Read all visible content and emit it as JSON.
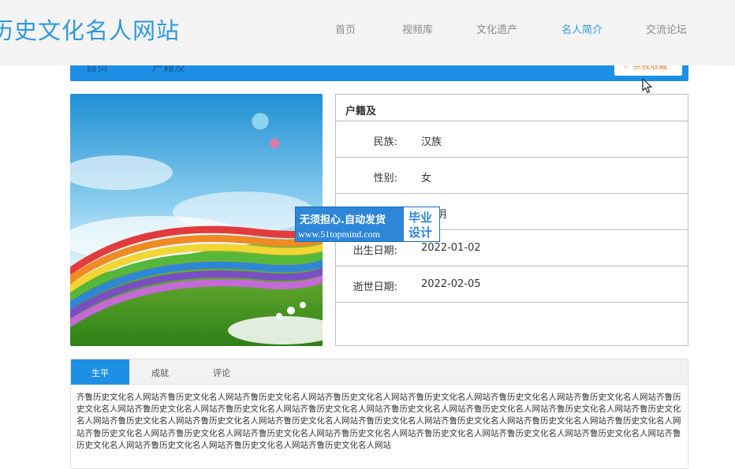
{
  "header": {
    "site_title": "历史文化名人网站",
    "nav": [
      {
        "label": "首页",
        "active": false
      },
      {
        "label": "视频库",
        "active": false
      },
      {
        "label": "文化遗产",
        "active": false
      },
      {
        "label": "名人简介",
        "active": true
      },
      {
        "label": "交流论坛",
        "active": false
      }
    ]
  },
  "breadcrumb": {
    "home": "首页",
    "current": "户籍及",
    "favorite_label": "☆ 点我收藏"
  },
  "person": {
    "name": "户籍及",
    "fields": [
      {
        "label": "民族:",
        "value": "汉族"
      },
      {
        "label": "性别:",
        "value": "女"
      },
      {
        "label": "",
        "value": "明"
      },
      {
        "label": "出生日期:",
        "value": "2022-01-02"
      },
      {
        "label": "逝世日期:",
        "value": "2022-02-05"
      }
    ]
  },
  "watermark": {
    "line1": "无须担心.自动发货",
    "line2": "www.51topmind.com",
    "right_top": "毕业",
    "right_bottom": "设计"
  },
  "tabs": {
    "items": [
      {
        "label": "生平",
        "active": true
      },
      {
        "label": "成就",
        "active": false
      },
      {
        "label": "评论",
        "active": false
      }
    ],
    "content": "齐鲁历史文化名人网站齐鲁历史文化名人网站齐鲁历史文化名人网站齐鲁历史文化名人网站齐鲁历史文化名人网站齐鲁历史文化名人网站齐鲁历史文化名人网站齐鲁历史文化名人网站齐鲁历史文化名人网站齐鲁历史文化名人网站齐鲁历史文化名人网站齐鲁历史文化名人网站齐鲁历史文化名人网站齐鲁历史文化名人网站齐鲁历史文化名人网站齐鲁历史文化名人网站齐鲁历史文化名人网站齐鲁历史文化名人网站齐鲁历史文化名人网站齐鲁历史文化名人网站齐鲁历史文化名人网站齐鲁历史文化名人网站齐鲁历史文化名人网站齐鲁历史文化名人网站齐鲁历史文化名人网站齐鲁历史文化名人网站齐鲁历史文化名人网站齐鲁历史文化名人网站齐鲁历史文化名人网站齐鲁历史文化名人网站齐鲁历史文化名人网站齐鲁历史文化名人网站齐鲁历史文化名人网站"
  },
  "colors": {
    "accent": "#1d90e6",
    "title_blue": "#2f98df",
    "border": "#bdbdbd"
  }
}
